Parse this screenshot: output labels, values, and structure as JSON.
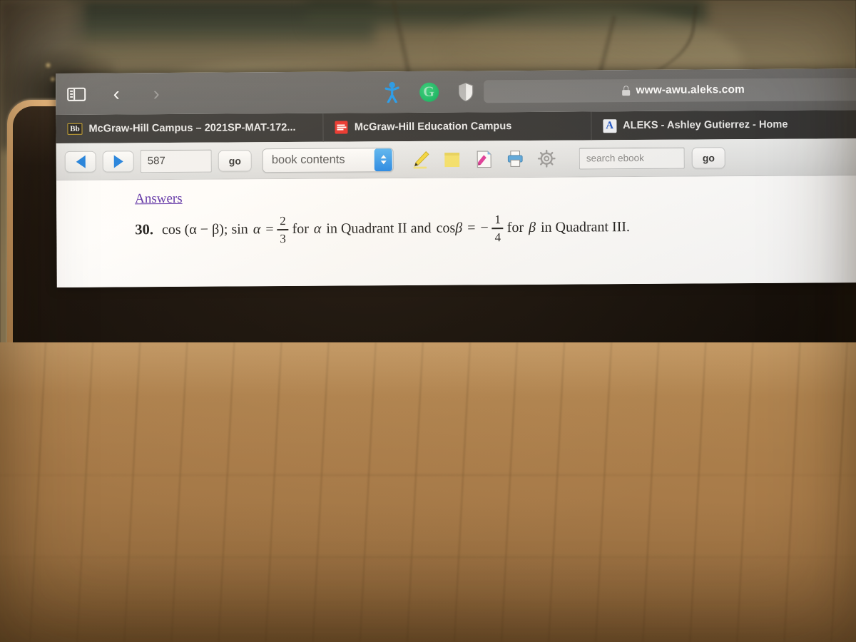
{
  "browser": {
    "toolbar": {
      "sidebar_icon": "sidebar-toggle-icon",
      "back_icon": "back-chevron-icon",
      "forward_icon": "forward-chevron-icon",
      "back_label": "‹",
      "forward_label": "›",
      "extensions": [
        {
          "name": "honey-extension-icon",
          "label": ""
        },
        {
          "name": "grammarly-extension-icon",
          "label": "G"
        },
        {
          "name": "shield-privacy-icon",
          "label": ""
        }
      ],
      "url": "www-awu.aleks.com",
      "lock_icon": "lock-icon"
    },
    "tabs": [
      {
        "favicon": "blackboard-favicon",
        "favicon_label": "Bb",
        "label": "McGraw-Hill Campus – 2021SP-MAT-172...",
        "active": false
      },
      {
        "favicon": "mcgraw-hill-favicon",
        "favicon_label": "",
        "label": "McGraw-Hill Education Campus",
        "active": false
      },
      {
        "favicon": "aleks-favicon",
        "favicon_label": "A",
        "label": "ALEKS - Ashley Gutierrez - Home",
        "active": true
      }
    ]
  },
  "ebook": {
    "prev_page_icon": "previous-page-icon",
    "next_page_icon": "next-page-icon",
    "page_number": "587",
    "go_label": "go",
    "contents_select": "book contents",
    "stepper_icon": "stepper-arrows-icon",
    "tools": [
      {
        "name": "highlighter-pencil-icon"
      },
      {
        "name": "sticky-note-icon"
      },
      {
        "name": "bookmark-page-icon"
      },
      {
        "name": "print-icon"
      },
      {
        "name": "settings-gear-icon"
      }
    ],
    "search_placeholder": "search ebook",
    "search_value": "",
    "search_go_label": "go",
    "content": {
      "answers_link": "Answers",
      "problem_number": "30.",
      "expr_prefix": "cos (α − β); sin",
      "alpha": "α",
      "equals": "=",
      "frac1_num": "2",
      "frac1_den": "3",
      "mid_text_1": "for",
      "mid_alpha": "α",
      "mid_text_2": "in Quadrant II and",
      "cos_label": "cos",
      "beta": "β",
      "equals2": "=",
      "minus": "−",
      "frac2_num": "1",
      "frac2_den": "4",
      "end_text_1": "for",
      "end_beta": "β",
      "end_text_2": "in Quadrant III."
    }
  },
  "colors": {
    "toolbar_gray": "#686868",
    "tabbar_dark": "#343434",
    "accent_blue": "#1a7fe0",
    "link_purple": "#5b2ea8",
    "laptop_edge": "#d8a268",
    "fabric_tan": "#a87b49"
  }
}
